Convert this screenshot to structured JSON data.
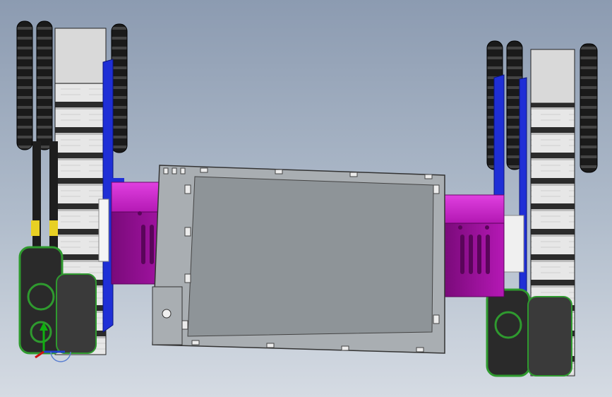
{
  "viewport": {
    "background_top": "#8c9bb1",
    "background_bottom": "#d5dbe3"
  },
  "model": {
    "colors": {
      "chassis": "#8e9498",
      "chassis_frame": "#a9aeb2",
      "motor": "#cc1fcc",
      "motor_dark": "#8c0d8c",
      "side_plate": "#1f2fd6",
      "track_link": "#e7e7e7",
      "track_dark": "#2b2b2b",
      "sprocket": "#1a1a1a",
      "bolt_ring": "#2f9a2f",
      "highlight": "#e8d024"
    }
  },
  "triad": {
    "icon": "coordinate-triad-icon",
    "axis_colors": [
      "#d01010",
      "#10b010",
      "#2040d0"
    ]
  }
}
